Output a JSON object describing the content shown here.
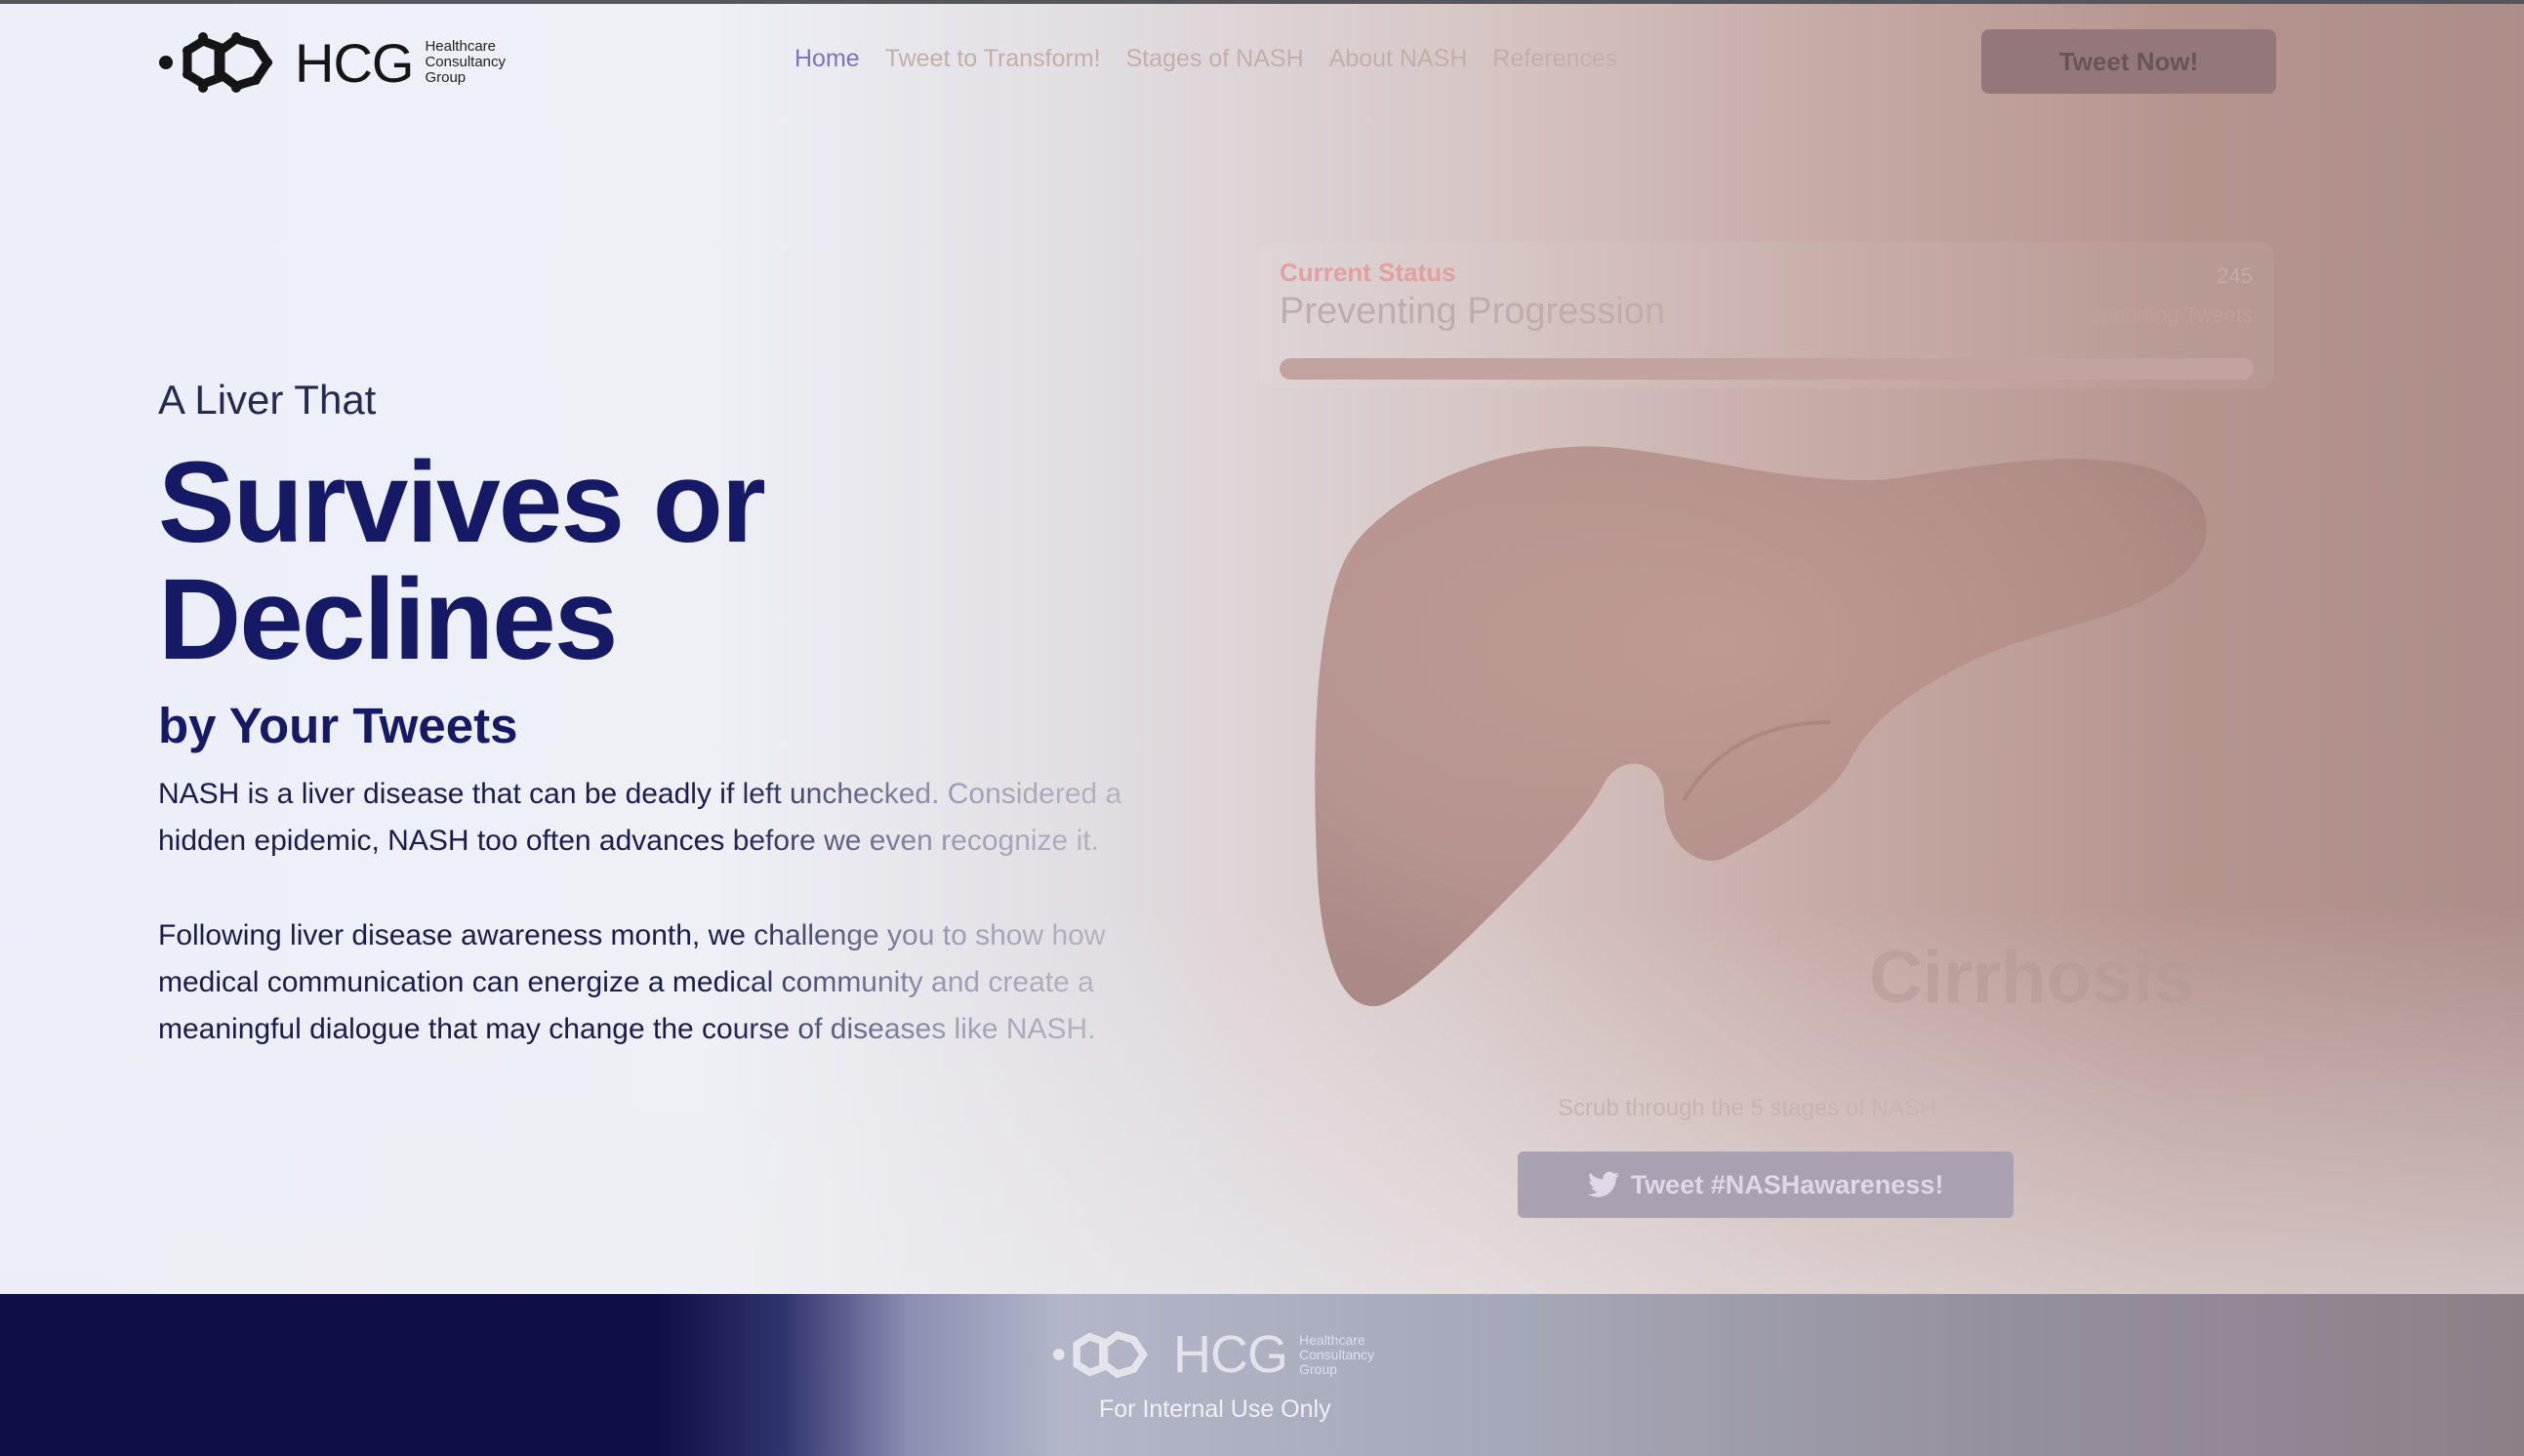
{
  "brand": {
    "wordmark": "HCG",
    "subtitle_lines": [
      "Healthcare",
      "Consultancy",
      "Group"
    ]
  },
  "nav": {
    "items": [
      "Home",
      "Tweet to Transform!",
      "Stages of NASH",
      "About NASH",
      "References"
    ],
    "active_index": 0
  },
  "header": {
    "cta_label": "Tweet Now!"
  },
  "hero": {
    "kicker": "A Liver That",
    "headline_line1": "Survives or",
    "headline_line2": "Declines",
    "subhead": "by Your Tweets",
    "paragraph1": "NASH is a liver disease that can be deadly if left unchecked. Considered a hidden epidemic, NASH too often advances before we even recognize it.",
    "paragraph2": "Following liver disease awareness month, we challenge you to show how medical communication can energize a medical community and create a meaningful dialogue that may change the course of diseases like NASH."
  },
  "status": {
    "label": "Current Status",
    "title": "Preventing Progression",
    "count": "245",
    "count_label": "Supporting Tweets",
    "progress_fraction": 1.0
  },
  "liver": {
    "stage_name": "Cirrhosis",
    "scrub_hint": "Scrub through the 5 stages of NASH",
    "tweet_button": "Tweet #NASHawareness!"
  },
  "footer": {
    "note": "For Internal Use Only"
  },
  "colors": {
    "navy": "#161a66",
    "nav_active": "#7a74c4",
    "status_label": "#e3a0a0",
    "footer_bg": "#0e0f45"
  },
  "icons": {
    "logo": "hcg-molecule-logo",
    "tweet": "twitter-bird-icon"
  }
}
